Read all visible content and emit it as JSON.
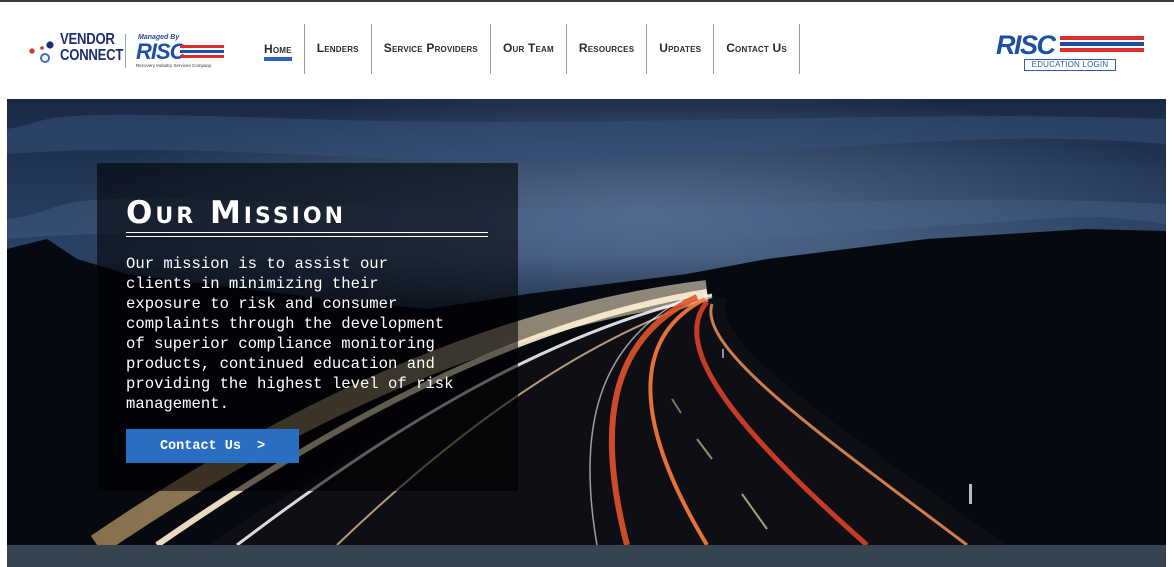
{
  "header": {
    "vendor_logo": {
      "line1": "VENDOR",
      "line2": "CONNECT",
      "managed_by": "Managed By",
      "brand": "RISC",
      "tagline": "Recovery Industry Services Company"
    },
    "nav": [
      {
        "label": "Home",
        "active": true
      },
      {
        "label": "Lenders",
        "active": false
      },
      {
        "label": "Service Providers",
        "active": false
      },
      {
        "label": "Our Team",
        "active": false
      },
      {
        "label": "Resources",
        "active": false
      },
      {
        "label": "Updates",
        "active": false
      },
      {
        "label": "Contact Us",
        "active": false
      }
    ],
    "risc_logo": {
      "brand": "RISC",
      "education_login": "EDUCATION LOGIN"
    }
  },
  "hero": {
    "title": "Our Mission",
    "body": "Our mission is to assist our\nclients in minimizing their\nexposure to risk and consumer\ncomplaints through the development\nof superior compliance monitoring\nproducts, continued education and\nproviding the highest level of risk\nmanagement.",
    "button_label": "Contact Us",
    "button_chevron": ">"
  },
  "colors": {
    "brand_blue": "#1d4fa8",
    "brand_red": "#d9302c",
    "button_blue": "#2a6ec2",
    "footer_band": "#364350"
  }
}
